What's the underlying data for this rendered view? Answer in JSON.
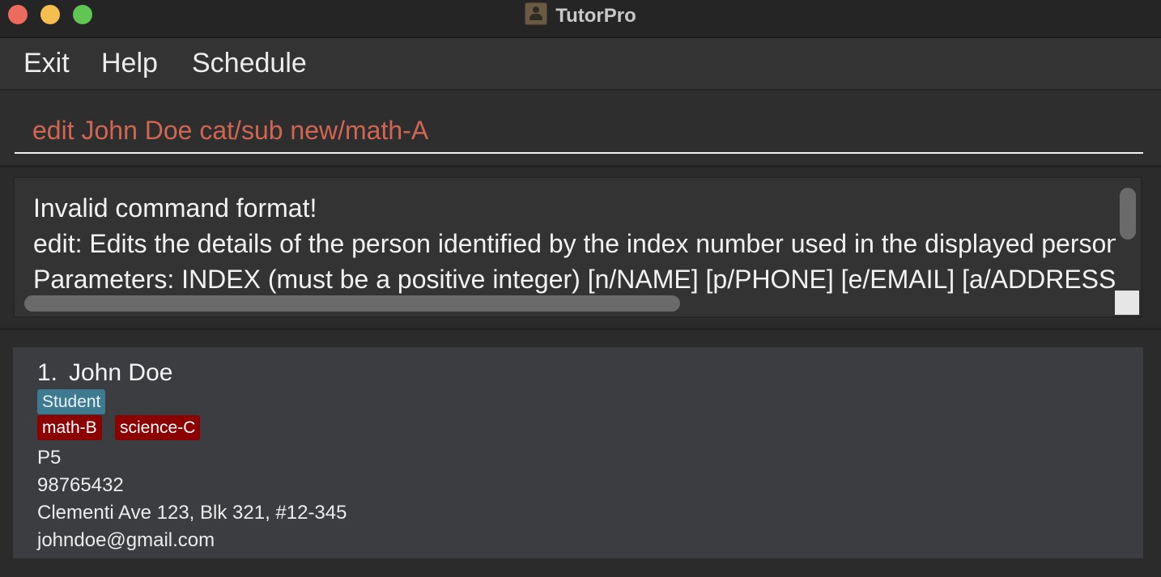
{
  "window": {
    "title": "TutorPro",
    "app_icon": "contact-book-icon"
  },
  "menu": {
    "items": [
      "Exit",
      "Help",
      "Schedule"
    ]
  },
  "command_box": {
    "value": "edit John Doe cat/sub new/math-A",
    "text_color": "#d06651"
  },
  "result_display": {
    "lines": [
      "Invalid command format!",
      "edit: Edits the details of the person identified by the index number used in the displayed person list.",
      "Parameters: INDEX (must be a positive integer) [n/NAME] [p/PHONE] [e/EMAIL] [a/ADDRESS]"
    ]
  },
  "person_list": {
    "persons": [
      {
        "index": "1.",
        "name": "John Doe",
        "role": "Student",
        "subjects": [
          "math-B",
          "science-C"
        ],
        "level": "P5",
        "phone": "98765432",
        "address": "Clementi Ave 123, Blk 321, #12-345",
        "email": "johndoe@gmail.com"
      }
    ]
  },
  "colors": {
    "role_tag": "#3e7b91",
    "subject_tag": "#8b0000"
  }
}
